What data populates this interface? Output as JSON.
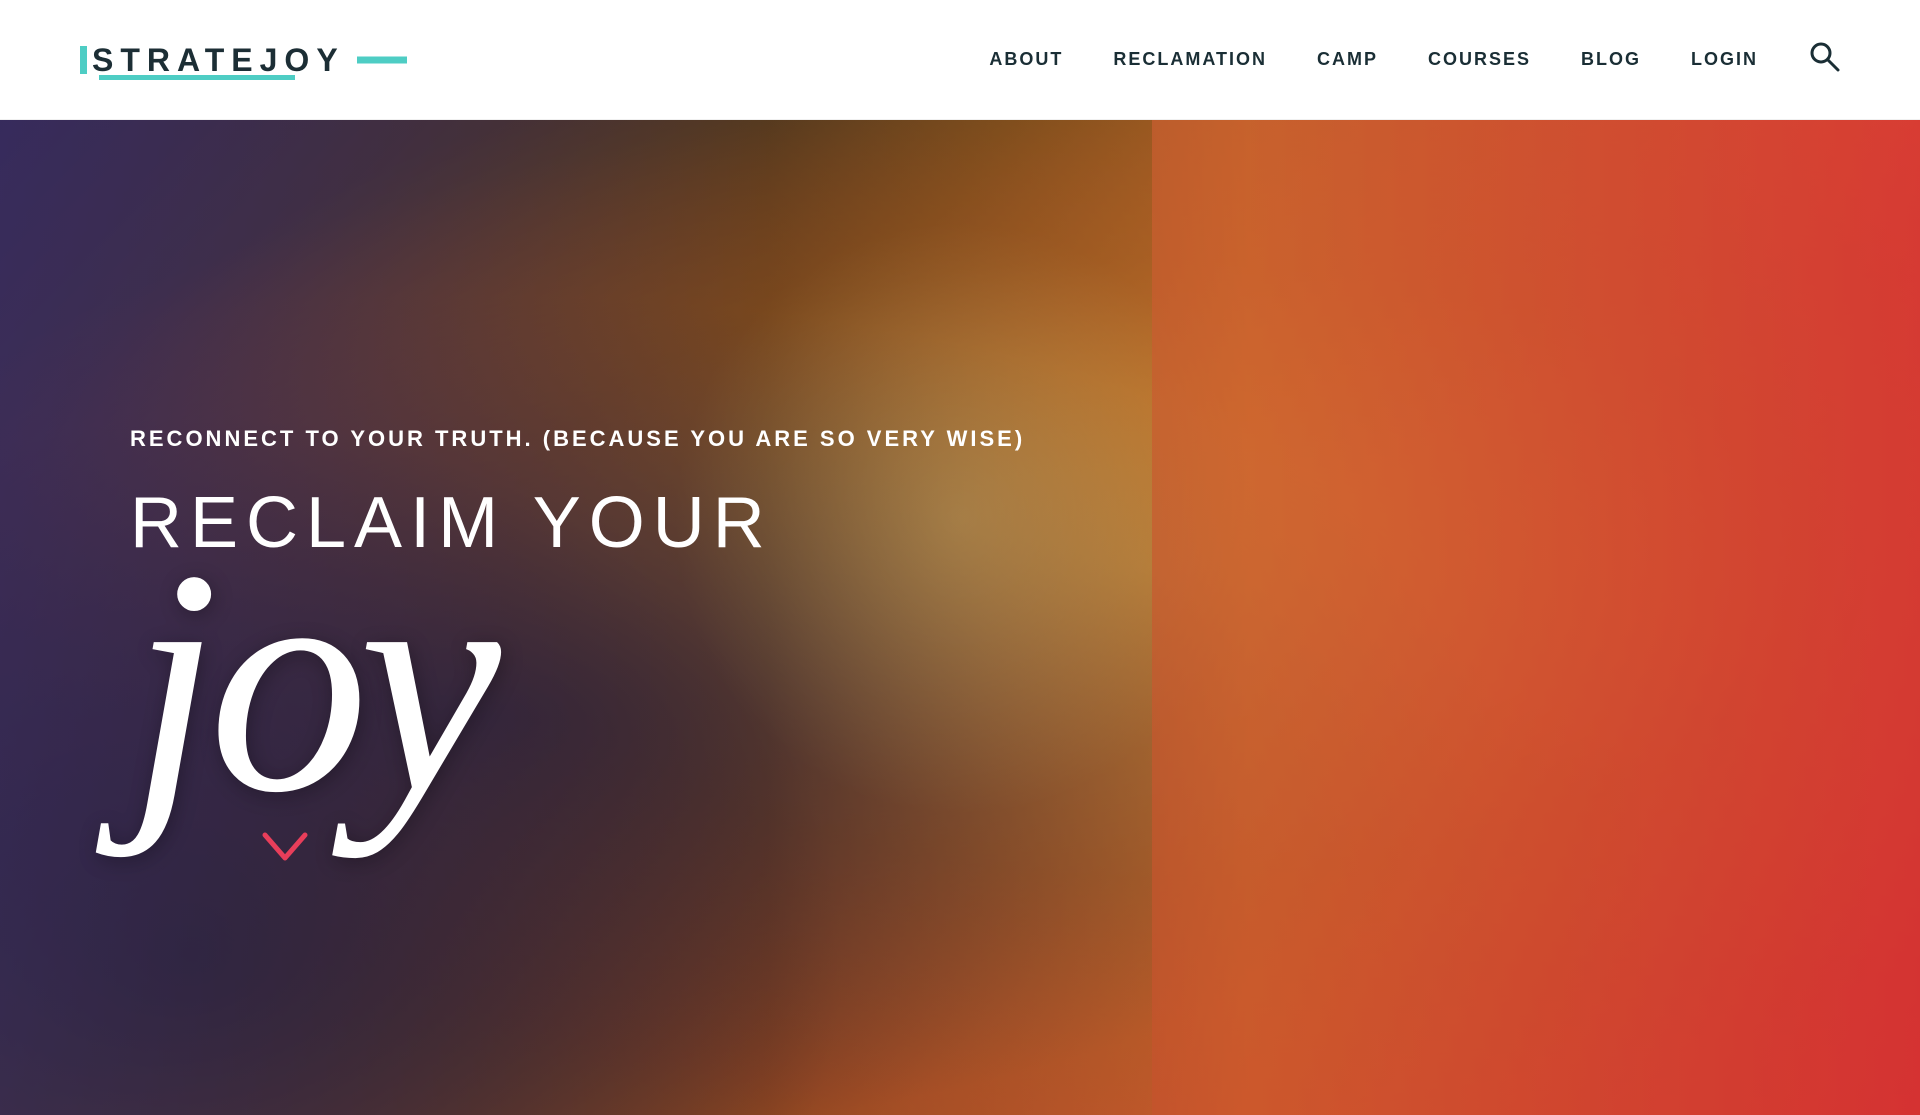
{
  "header": {
    "logo": {
      "text": "STRATEJOY",
      "accent_color": "#4ecdc4"
    },
    "nav": {
      "links": [
        {
          "label": "ABOUT",
          "id": "about"
        },
        {
          "label": "RECLAMATION",
          "id": "reclamation"
        },
        {
          "label": "CAMP",
          "id": "camp"
        },
        {
          "label": "COURSES",
          "id": "courses"
        },
        {
          "label": "BLOG",
          "id": "blog"
        },
        {
          "label": "LOGIN",
          "id": "login"
        }
      ],
      "search_icon": "🔍"
    }
  },
  "hero": {
    "subtitle": "RECONNECT TO YOUR TRUTH. (BECAUSE YOU ARE SO VERY WISE)",
    "title_line1": "RECLAIM YOUR",
    "title_line2": "joy",
    "scroll_indicator": "❯"
  }
}
